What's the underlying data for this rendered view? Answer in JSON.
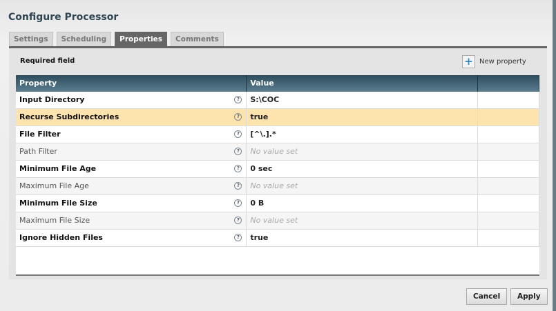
{
  "title": "Configure Processor",
  "tabs": [
    "Settings",
    "Scheduling",
    "Properties",
    "Comments"
  ],
  "active_tab": "Properties",
  "required_label": "Required field",
  "new_property_label": "New property",
  "columns": [
    "Property",
    "Value",
    ""
  ],
  "rows": [
    {
      "name": "Input Directory",
      "value": "S:\\COC",
      "required": true
    },
    {
      "name": "Recurse Subdirectories",
      "value": "true",
      "required": true,
      "selected": true
    },
    {
      "name": "File Filter",
      "value": "[^\\.].*",
      "required": true
    },
    {
      "name": "Path Filter",
      "value": "No value set",
      "required": false,
      "empty": true
    },
    {
      "name": "Minimum File Age",
      "value": "0 sec",
      "required": true
    },
    {
      "name": "Maximum File Age",
      "value": "No value set",
      "required": false,
      "empty": true
    },
    {
      "name": "Minimum File Size",
      "value": "0 B",
      "required": true
    },
    {
      "name": "Maximum File Size",
      "value": "No value set",
      "required": false,
      "empty": true
    },
    {
      "name": "Ignore Hidden Files",
      "value": "true",
      "required": true
    }
  ],
  "help_glyph": "?",
  "buttons": {
    "cancel": "Cancel",
    "apply": "Apply"
  }
}
